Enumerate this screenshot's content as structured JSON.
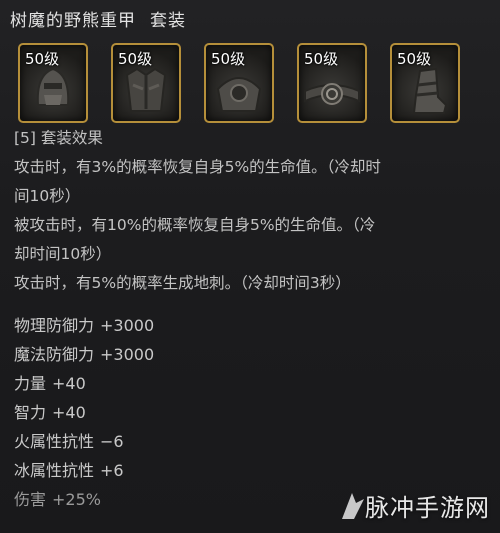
{
  "title": {
    "item_name": "树魔的野熊重甲",
    "set_tag": "套装"
  },
  "slots": [
    {
      "level": "50级",
      "icon": "helmet-icon"
    },
    {
      "level": "50级",
      "icon": "chest-armor-icon"
    },
    {
      "level": "50级",
      "icon": "pauldron-icon"
    },
    {
      "level": "50级",
      "icon": "belt-icon"
    },
    {
      "level": "50级",
      "icon": "boots-icon"
    }
  ],
  "set_effect": {
    "header": "[5] 套装效果",
    "lines": [
      "攻击时，有3%的概率恢复自身5%的生命值。（冷却时",
      "间10秒）",
      "被攻击时，有10%的概率恢复自身5%的生命值。（冷",
      "却时间10秒）",
      "攻击时，有5%的概率生成地刺。（冷却时间3秒）"
    ]
  },
  "stats": [
    {
      "name": "物理防御力",
      "value": "+3000"
    },
    {
      "name": "魔法防御力",
      "value": "+3000"
    },
    {
      "name": "力量",
      "value": "+40"
    },
    {
      "name": "智力",
      "value": "+40"
    },
    {
      "name": "火属性抗性",
      "value": "−6"
    },
    {
      "name": "冰属性抗性",
      "value": "+6"
    },
    {
      "name": "伤害",
      "value": "+25%"
    }
  ],
  "watermark": {
    "text": "脉冲手游网"
  },
  "colors": {
    "slot_border": "#b58f3a",
    "text": "#c9c9c9",
    "background": "#1b1b1d"
  }
}
